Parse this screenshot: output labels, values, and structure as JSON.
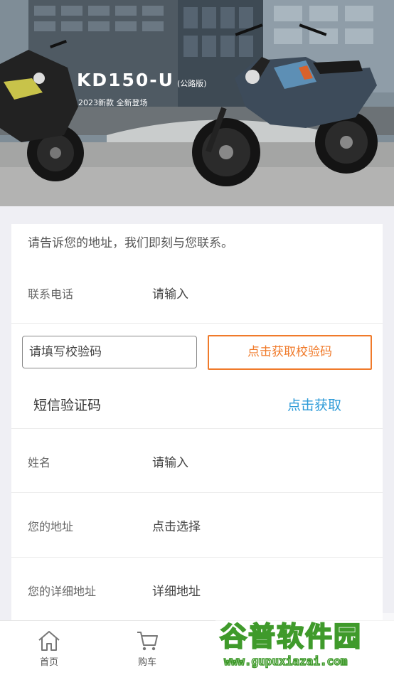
{
  "banner": {
    "model": "KD150-U",
    "model_note": "(公路版)",
    "subtitle": "2023新款 全新登场"
  },
  "form": {
    "intro": "请告诉您的地址，我们即刻与您联系。",
    "phone": {
      "label": "联系电话",
      "placeholder": "请输入"
    },
    "captcha": {
      "placeholder": "请填写校验码",
      "button": "点击获取校验码"
    },
    "sms": {
      "label": "短信验证码",
      "action": "点击获取"
    },
    "name": {
      "label": "姓名",
      "placeholder": "请输入"
    },
    "address": {
      "label": "您的地址",
      "placeholder": "点击选择"
    },
    "detail_address": {
      "label": "您的详细地址",
      "placeholder": "详细地址"
    }
  },
  "tabbar": {
    "items": [
      {
        "label": "首页",
        "icon": "home-icon"
      },
      {
        "label": "购车",
        "icon": "cart-icon"
      }
    ]
  },
  "watermark": {
    "logo": "谷普软件园",
    "url": "www.gupuxiazai.com"
  },
  "colors": {
    "accent": "#f07a2a",
    "link": "#2e9bd8",
    "watermark": "#3f9a2b"
  }
}
